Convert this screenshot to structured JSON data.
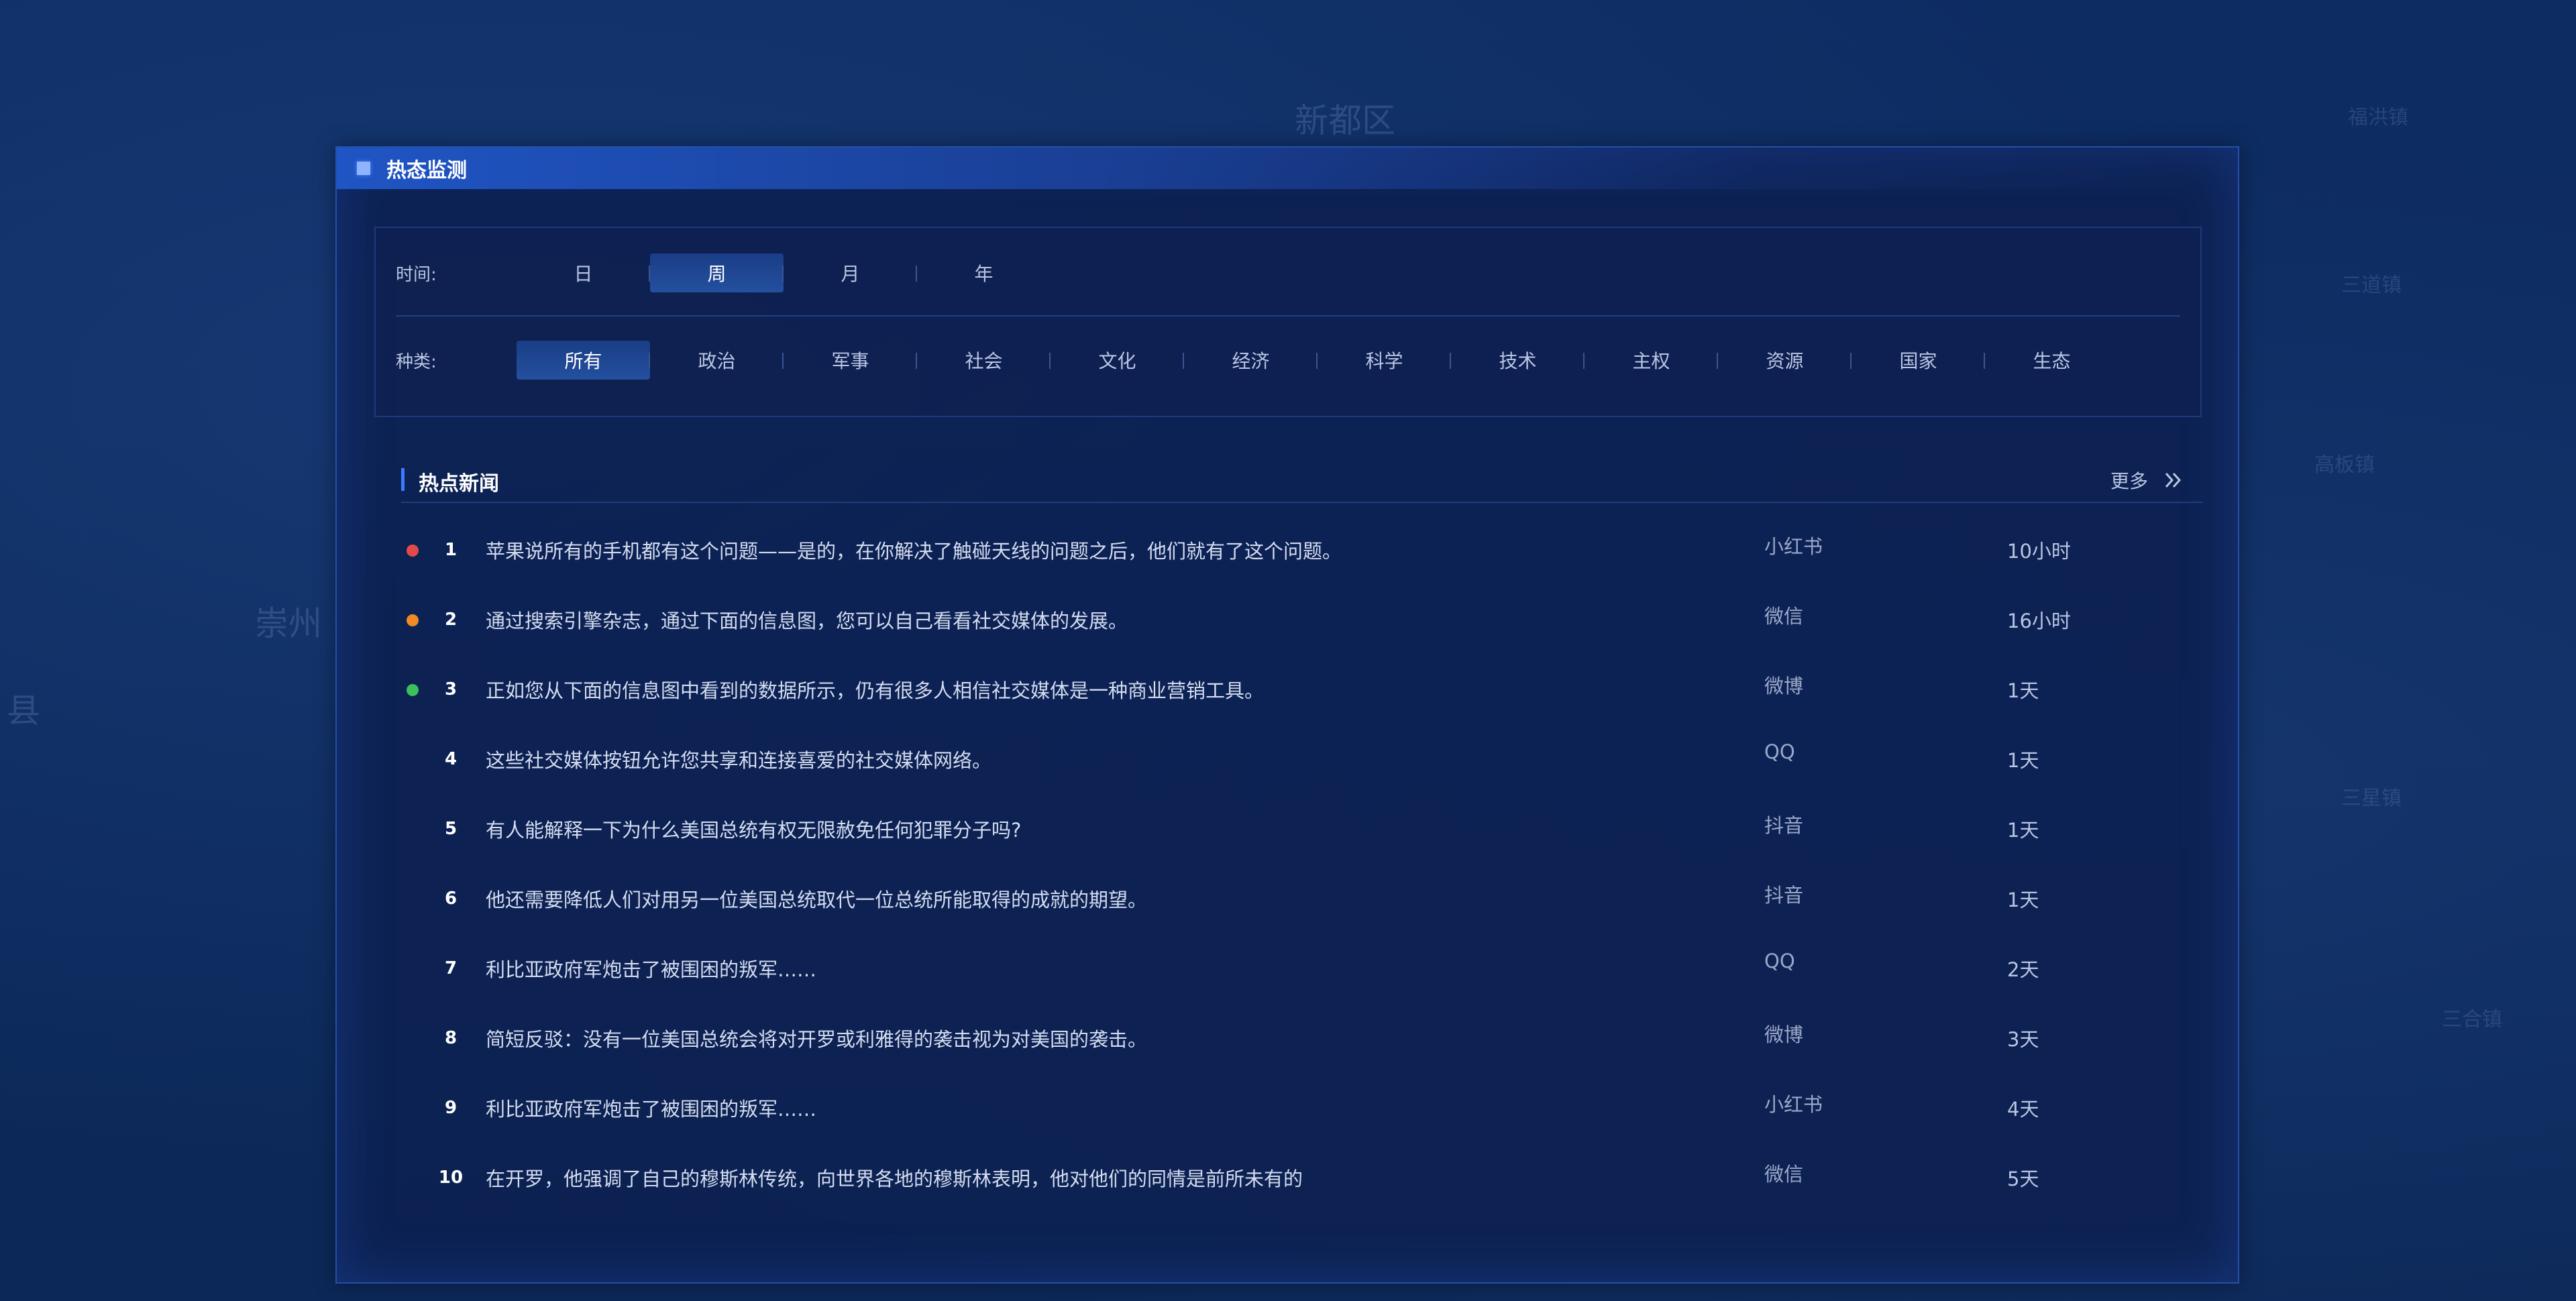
{
  "colors": {
    "accent": "#3d7bff",
    "dot_red": "#e24a4a",
    "dot_orange": "#f08a24",
    "dot_green": "#3dbf5a"
  },
  "map_labels": [
    "新都区",
    "崇州",
    "县",
    "三星镇",
    "三道镇",
    "高板镇",
    "三合镇",
    "福洪镇"
  ],
  "panel": {
    "title": "热态监测"
  },
  "filters": {
    "time_label": "时间:",
    "time_options": [
      "日",
      "周",
      "月",
      "年"
    ],
    "time_selected": "周",
    "kind_label": "种类:",
    "kind_options": [
      "所有",
      "政治",
      "军事",
      "社会",
      "文化",
      "经济",
      "科学",
      "技术",
      "主权",
      "资源",
      "国家",
      "生态"
    ],
    "kind_selected": "所有"
  },
  "news": {
    "title": "热点新闻",
    "more_label": "更多",
    "items": [
      {
        "rank": "1",
        "dot": "red",
        "text": "苹果说所有的手机都有这个问题——是的，在你解决了触碰天线的问题之后，他们就有了这个问题。",
        "source": "小红书",
        "time": "10小时"
      },
      {
        "rank": "2",
        "dot": "orange",
        "text": "通过搜索引擎杂志，通过下面的信息图，您可以自己看看社交媒体的发展。",
        "source": "微信",
        "time": "16小时"
      },
      {
        "rank": "3",
        "dot": "green",
        "text": "正如您从下面的信息图中看到的数据所示，仍有很多人相信社交媒体是一种商业营销工具。",
        "source": "微博",
        "time": "1天"
      },
      {
        "rank": "4",
        "dot": "",
        "text": "这些社交媒体按钮允许您共享和连接喜爱的社交媒体网络。",
        "source": "QQ",
        "time": "1天"
      },
      {
        "rank": "5",
        "dot": "",
        "text": "有人能解释一下为什么美国总统有权无限赦免任何犯罪分子吗?",
        "source": "抖音",
        "time": "1天"
      },
      {
        "rank": "6",
        "dot": "",
        "text": "他还需要降低人们对用另一位美国总统取代一位总统所能取得的成就的期望。",
        "source": "抖音",
        "time": "1天"
      },
      {
        "rank": "7",
        "dot": "",
        "text": "利比亚政府军炮击了被围困的叛军……",
        "source": "QQ",
        "time": "2天"
      },
      {
        "rank": "8",
        "dot": "",
        "text": "简短反驳：没有一位美国总统会将对开罗或利雅得的袭击视为对美国的袭击。",
        "source": "微博",
        "time": "3天"
      },
      {
        "rank": "9",
        "dot": "",
        "text": "利比亚政府军炮击了被围困的叛军……",
        "source": "小红书",
        "time": "4天"
      },
      {
        "rank": "10",
        "dot": "",
        "text": "在开罗，他强调了自己的穆斯林传统，向世界各地的穆斯林表明，他对他们的同情是前所未有的",
        "source": "微信",
        "time": "5天"
      }
    ]
  }
}
